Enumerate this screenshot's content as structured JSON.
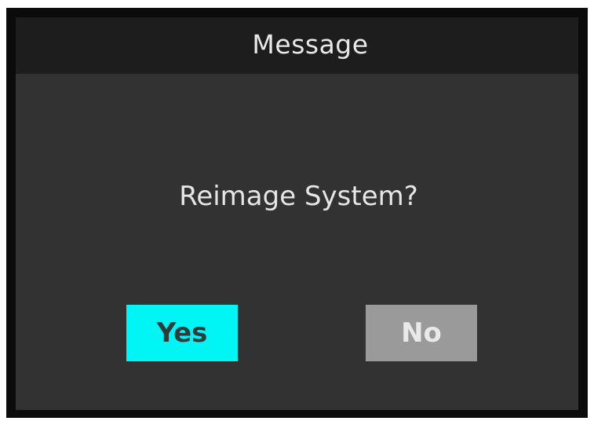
{
  "dialog": {
    "title": "Message",
    "message": "Reimage System?",
    "buttons": {
      "yes_label": "Yes",
      "no_label": "No"
    },
    "colors": {
      "title_bar": "#1d1d1d",
      "body": "#323232",
      "frame": "#0b0b0b",
      "yes_button": "#00f5f5",
      "no_button": "#9a9a9a"
    }
  }
}
